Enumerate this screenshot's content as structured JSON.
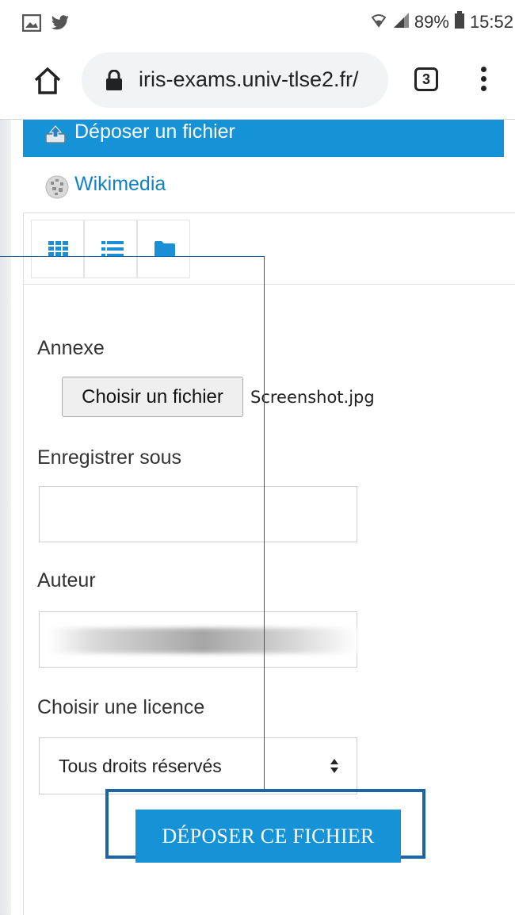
{
  "status_bar": {
    "battery": "89%",
    "time": "15:52",
    "left_icons": [
      "image-icon",
      "twitter-icon"
    ],
    "right_icons": [
      "wifi-icon",
      "signal-icon",
      "battery-icon"
    ]
  },
  "browser": {
    "url": "iris-exams.univ-tlse2.fr/",
    "tab_count": "3"
  },
  "file_picker": {
    "upload_label": "Déposer un fichier",
    "wikimedia_label": "Wikimedia",
    "view_buttons": [
      "grid-view-icon",
      "list-view-icon",
      "folder-view-icon"
    ]
  },
  "form": {
    "attachment_label": "Annexe",
    "choose_file_label": "Choisir un fichier",
    "file_name": "Screenshot.jpg",
    "save_as_label": "Enregistrer sous",
    "save_as_value": "",
    "author_label": "Auteur",
    "license_label": "Choisir une licence",
    "license_value": "Tous droits réservés",
    "submit_label": "DÉPOSER CE FICHIER"
  },
  "colors": {
    "accent": "#1692d6",
    "link": "#1182c3",
    "annotation": "#1d63a8"
  }
}
